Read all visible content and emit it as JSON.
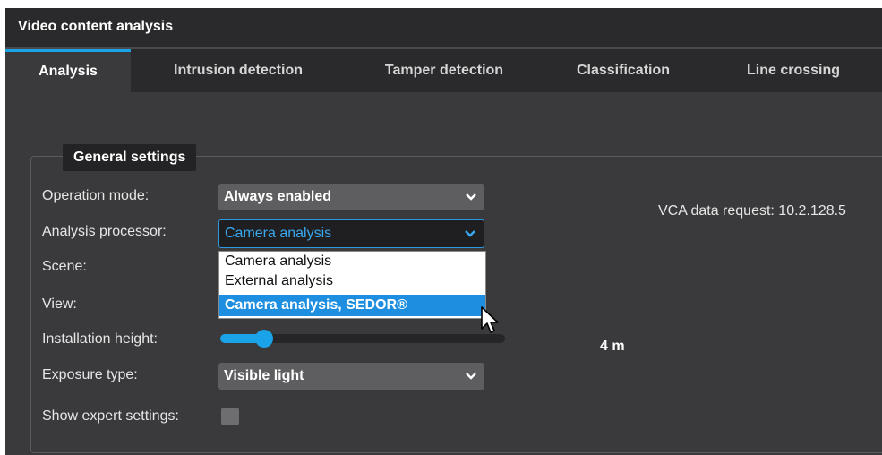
{
  "window": {
    "title": "Video content analysis"
  },
  "tabs": [
    {
      "label": "Analysis",
      "active": true
    },
    {
      "label": "Intrusion detection",
      "active": false
    },
    {
      "label": "Tamper detection",
      "active": false
    },
    {
      "label": "Classification",
      "active": false
    },
    {
      "label": "Line crossing",
      "active": false
    }
  ],
  "general_settings": {
    "legend": "General settings",
    "operation_mode": {
      "label": "Operation mode:",
      "value": "Always enabled"
    },
    "analysis_processor": {
      "label": "Analysis processor:",
      "value": "Camera analysis",
      "options": [
        "Camera analysis",
        "External analysis",
        "Camera analysis, SEDOR®"
      ],
      "highlighted": "Camera analysis, SEDOR®"
    },
    "scene": {
      "label": "Scene:"
    },
    "view": {
      "label": "View:"
    },
    "installation_height": {
      "label": "Installation height:",
      "value_text": "4 m",
      "fraction": 0.16
    },
    "exposure_type": {
      "label": "Exposure type:",
      "value": "Visible light"
    },
    "show_expert_settings": {
      "label": "Show expert settings:",
      "checked": false
    },
    "vca_data_request": "VCA data request: 10.2.128.5"
  },
  "icons": {
    "select_chevron": "chevron-down-icon",
    "cursor": "mouse-pointer-icon"
  },
  "colors": {
    "accent": "#1aa3e8",
    "panel": "#3a3a3c",
    "header": "#2a2a2c",
    "highlight": "#1e8fe0"
  }
}
